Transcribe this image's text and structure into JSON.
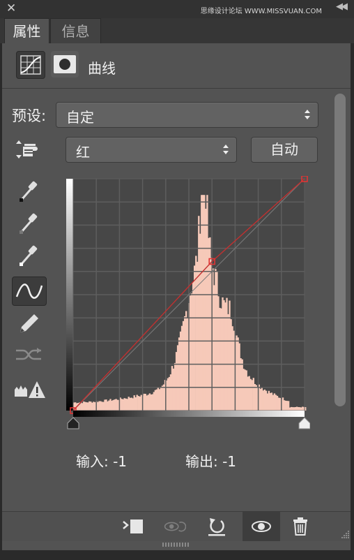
{
  "titlebar": {
    "watermark": "思缘设计论坛 WWW.MISSVUAN.COM"
  },
  "tabs": [
    {
      "label": "属性"
    },
    {
      "label": "信息"
    }
  ],
  "properties": {
    "title": "曲线",
    "preset_label": "预设:",
    "preset_value": "自定",
    "channel_value": "红",
    "auto_label": "自动",
    "input_label": "输入: -1",
    "output_label": "输出: -1"
  },
  "tools": [
    "on-image-adjust-icon",
    "sample-black-eyedropper-icon",
    "sample-gray-eyedropper-icon",
    "sample-white-eyedropper-icon",
    "edit-points-curve-icon",
    "pencil-draw-icon",
    "smooth-curve-icon",
    "clipping-warning-icon"
  ],
  "colors": {
    "panel": "#535353",
    "curve": "#c23030",
    "histogram": "#f6c9b9",
    "accent_point": "#e03535"
  },
  "curve_points": [
    {
      "input": 0,
      "output": 0
    },
    {
      "input": 153,
      "output": 164
    },
    {
      "input": 255,
      "output": 255
    }
  ],
  "bottom_icons": [
    "clip-to-layer-icon",
    "toggle-previous-state-icon",
    "reset-icon",
    "visibility-eye-icon",
    "trash-icon"
  ]
}
